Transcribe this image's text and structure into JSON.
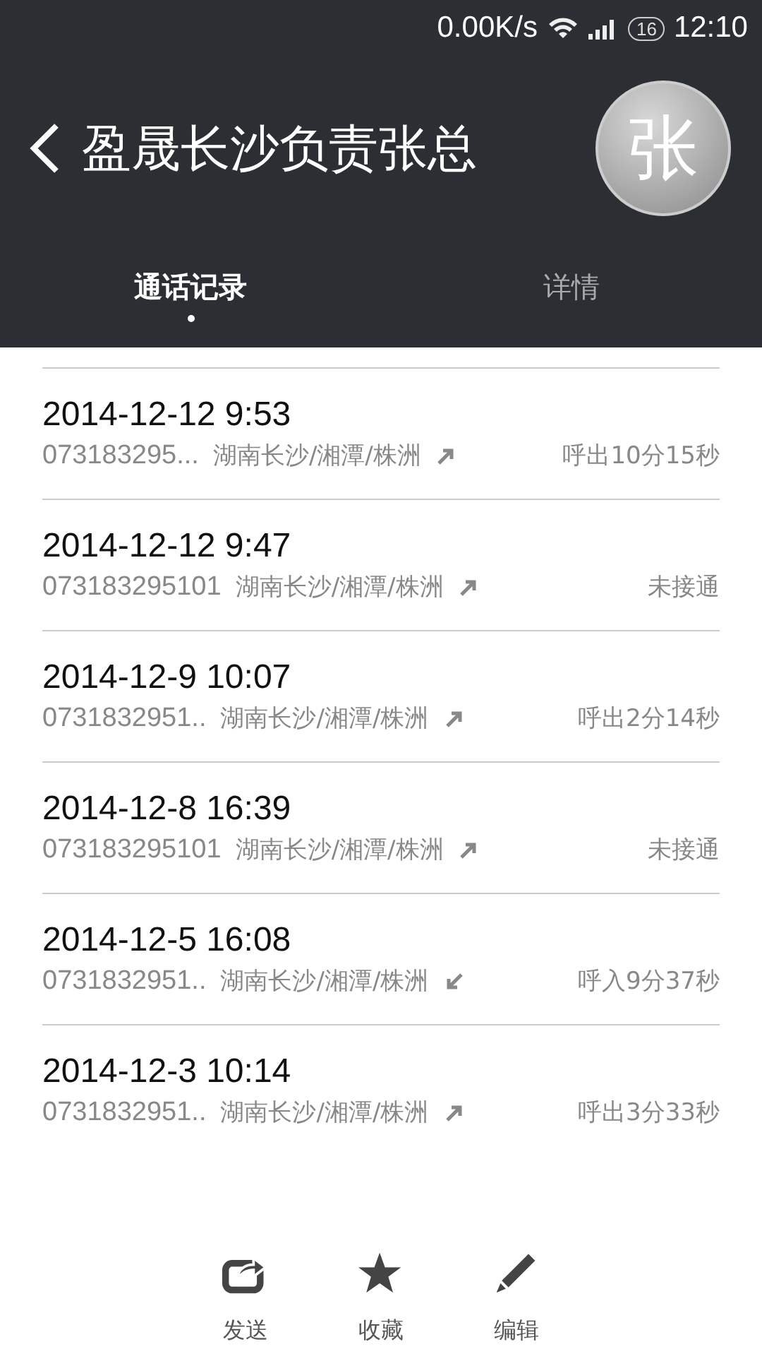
{
  "status_bar": {
    "speed": "0.00K/s",
    "sim": "16",
    "time": "12:10"
  },
  "header": {
    "title": "盈晟长沙负责张总",
    "avatar": "张"
  },
  "tabs": [
    {
      "label": "通话记录",
      "selected": true
    },
    {
      "label": "详情",
      "selected": false
    }
  ],
  "calls": [
    {
      "time": "2014-12-12 9:53",
      "number": "073183295...",
      "location": "湖南长沙/湘潭/株洲",
      "kind": "outgoing",
      "result": "呼出10分15秒"
    },
    {
      "time": "2014-12-12 9:47",
      "number": "073183295101",
      "location": "湖南长沙/湘潭/株洲",
      "kind": "outgoing",
      "result": "未接通"
    },
    {
      "time": "2014-12-9 10:07",
      "number": "0731832951..",
      "location": "湖南长沙/湘潭/株洲",
      "kind": "outgoing",
      "result": "呼出2分14秒"
    },
    {
      "time": "2014-12-8 16:39",
      "number": "073183295101",
      "location": "湖南长沙/湘潭/株洲",
      "kind": "outgoing",
      "result": "未接通"
    },
    {
      "time": "2014-12-5 16:08",
      "number": "0731832951..",
      "location": "湖南长沙/湘潭/株洲",
      "kind": "incoming",
      "result": "呼入9分37秒"
    },
    {
      "time": "2014-12-3 10:14",
      "number": "0731832951..",
      "location": "湖南长沙/湘潭/株洲",
      "kind": "outgoing",
      "result": "呼出3分33秒"
    }
  ],
  "actions": [
    {
      "kind": "share",
      "label": "发送"
    },
    {
      "kind": "star",
      "label": "收藏"
    },
    {
      "kind": "edit",
      "label": "编辑"
    }
  ]
}
